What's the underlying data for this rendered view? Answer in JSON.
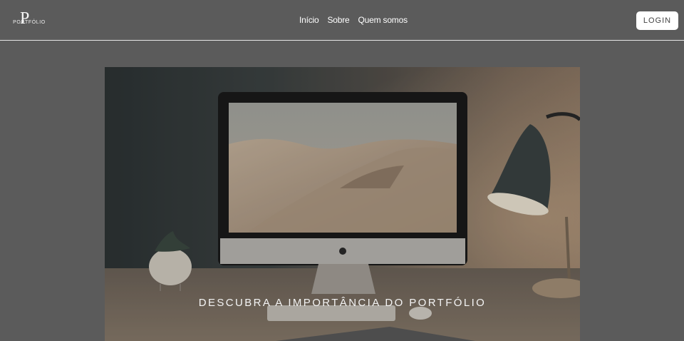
{
  "header": {
    "logo": {
      "letter": "P",
      "text": "PORTFÓLIO"
    },
    "nav": [
      {
        "label": "Início"
      },
      {
        "label": "Sobre"
      },
      {
        "label": "Quem somos"
      }
    ],
    "login_label": "LOGIN"
  },
  "hero": {
    "caption": "DESCUBRA A IMPORTÂNCIA DO PORTFÓLIO"
  },
  "colors": {
    "background": "#5b5b5b",
    "header_border": "#e6e6e6",
    "login_bg": "#ffffff"
  }
}
